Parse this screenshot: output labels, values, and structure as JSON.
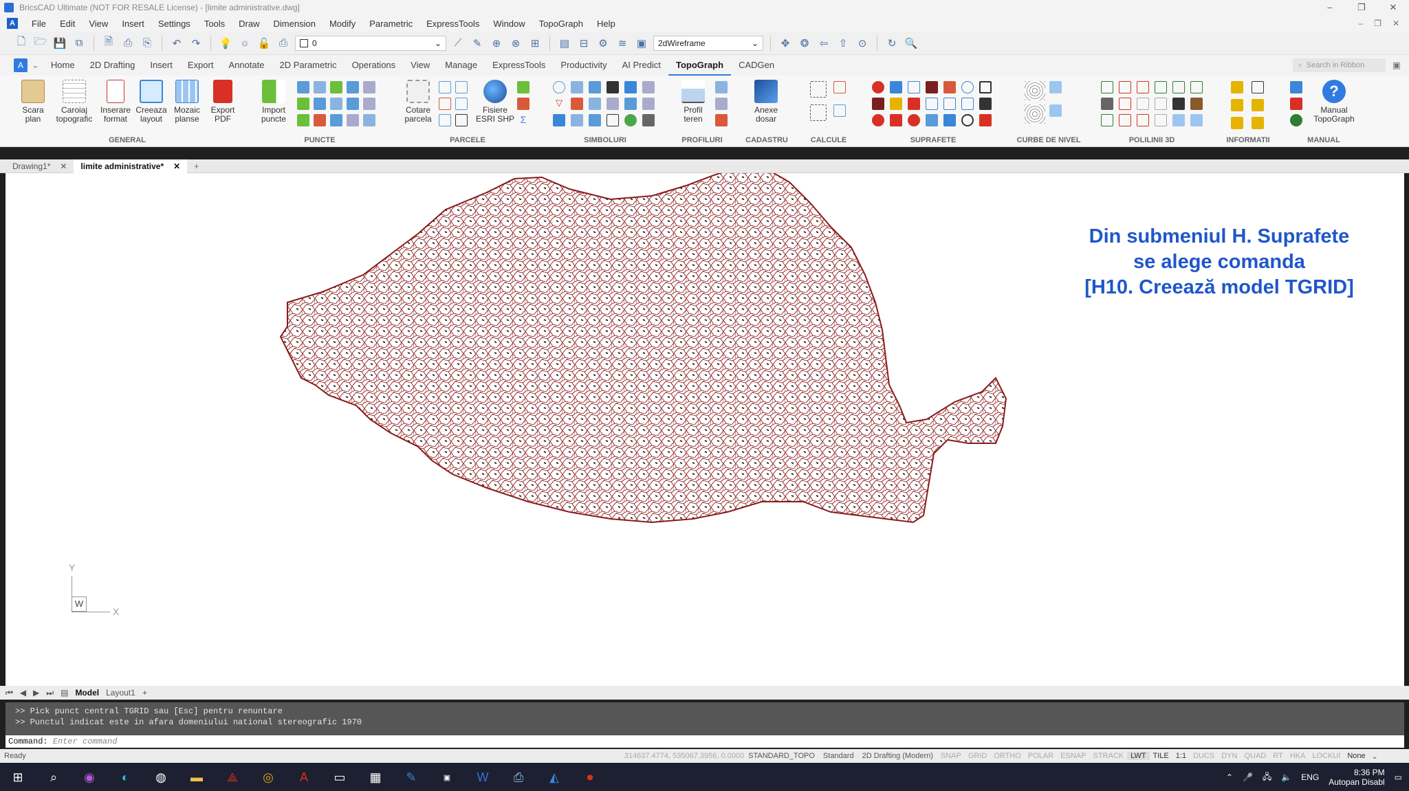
{
  "window": {
    "title": "BricsCAD Ultimate (NOT FOR RESALE License) - [limite administrative.dwg]",
    "controls": [
      "–",
      "❐",
      "✕"
    ]
  },
  "menu": {
    "items": [
      "File",
      "Edit",
      "View",
      "Insert",
      "Settings",
      "Tools",
      "Draw",
      "Dimension",
      "Modify",
      "Parametric",
      "ExpressTools",
      "Window",
      "TopoGraph",
      "Help"
    ]
  },
  "toolbar": {
    "layer_value": "0",
    "visual_style": "2dWireframe"
  },
  "ribbon_tabs": [
    "Home",
    "2D Drafting",
    "Insert",
    "Export",
    "Annotate",
    "2D Parametric",
    "Operations",
    "View",
    "Manage",
    "ExpressTools",
    "Productivity",
    "AI Predict",
    "TopoGraph",
    "CADGen"
  ],
  "ribbon_active_tab": "TopoGraph",
  "ribbon_search_placeholder": "Search in Ribbon",
  "ribbon_groups": {
    "general": {
      "name": "GENERAL",
      "buttons": [
        {
          "label1": "Scara",
          "label2": "plan"
        },
        {
          "label1": "Caroiaj",
          "label2": "topografic"
        },
        {
          "label1": "Inserare",
          "label2": "format"
        },
        {
          "label1": "Creeaza",
          "label2": "layout"
        },
        {
          "label1": "Mozaic",
          "label2": "planse"
        },
        {
          "label1": "Export",
          "label2": "PDF"
        }
      ]
    },
    "puncte": {
      "name": "PUNCTE",
      "button": {
        "label1": "Import",
        "label2": "puncte"
      }
    },
    "parcele": {
      "name": "PARCELE",
      "buttons": [
        {
          "label1": "Cotare",
          "label2": "parcela"
        },
        {
          "label1": "Fisiere",
          "label2": "ESRI SHP"
        }
      ]
    },
    "simboluri": {
      "name": "SIMBOLURI"
    },
    "profiluri": {
      "name": "PROFILURI",
      "button": {
        "label1": "Profil",
        "label2": "teren"
      }
    },
    "cadastru": {
      "name": "CADASTRU",
      "button": {
        "label1": "Anexe",
        "label2": "dosar"
      }
    },
    "calcule": {
      "name": "CALCULE"
    },
    "suprafete": {
      "name": "SUPRAFETE"
    },
    "curbe": {
      "name": "CURBE DE NIVEL"
    },
    "polilinii": {
      "name": "POLILINII 3D"
    },
    "informatii": {
      "name": "INFORMATII"
    },
    "manual": {
      "name": "MANUAL",
      "button": {
        "label1": "Manual",
        "label2": "TopoGraph"
      }
    }
  },
  "doc_tabs": [
    {
      "label": "Drawing1*"
    },
    {
      "label": "limite administrative*"
    }
  ],
  "overlay": {
    "line1": "Din submeniul H. Suprafete",
    "line2": "se alege comanda",
    "line3": "[H10. Creează model TGRID]"
  },
  "ucs": {
    "y": "Y",
    "x": "X",
    "w": "W"
  },
  "layout_tabs": [
    "Model",
    "Layout1"
  ],
  "command_history": [
    ">> Pick punct central TGRID sau [Esc] pentru renuntare",
    ">> Punctul indicat este in afara domeniului national stereografic 1970"
  ],
  "command_prompt": {
    "label": "Command:",
    "placeholder": "Enter command"
  },
  "status": {
    "ready": "Ready",
    "coords": "314637.4774, 535067.3956, 0.0000",
    "items": [
      "STANDARD_TOPO",
      "Standard",
      "2D Drafting (Modern)"
    ],
    "toggles": [
      "SNAP",
      "GRID",
      "ORTHO",
      "POLAR",
      "ESNAP",
      "STRACK",
      "LWT",
      "TILE",
      "1:1",
      "DUCS",
      "DYN",
      "QUAD",
      "RT",
      "HKA",
      "LOCKUI",
      "None"
    ]
  },
  "taskbar": {
    "language": "ENG",
    "time": "8:36 PM",
    "user": "Autopan Disabl"
  },
  "colors": {
    "accent": "#2f7be0",
    "overlay_text": "#1f57c9",
    "map_line": "#8b1a1a"
  }
}
